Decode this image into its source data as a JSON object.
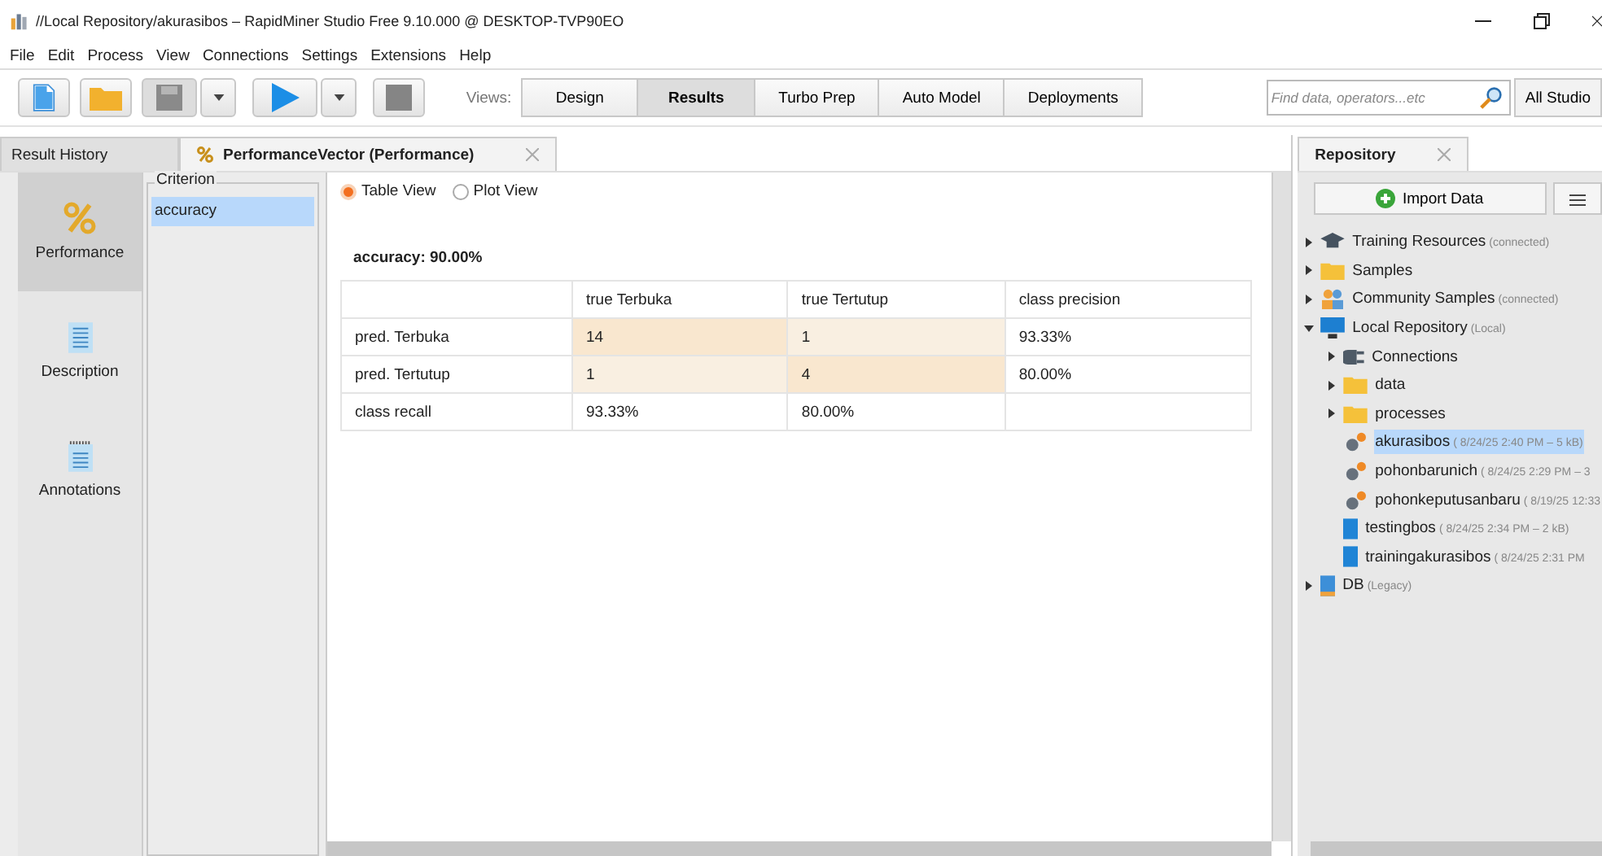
{
  "window": {
    "title": "//Local Repository/akurasibos – RapidMiner Studio Free 9.10.000 @ DESKTOP-TVP90EO"
  },
  "menu": [
    "File",
    "Edit",
    "Process",
    "View",
    "Connections",
    "Settings",
    "Extensions",
    "Help"
  ],
  "toolbar": {
    "views_label": "Views:",
    "views": [
      {
        "label": "Design",
        "selected": false
      },
      {
        "label": "Results",
        "selected": true
      },
      {
        "label": "Turbo Prep",
        "selected": false
      },
      {
        "label": "Auto Model",
        "selected": false
      },
      {
        "label": "Deployments",
        "selected": false
      }
    ],
    "search": {
      "placeholder": "Find data, operators...etc"
    },
    "scope": "All Studio"
  },
  "tabs": [
    {
      "label": "Result History",
      "selected": false,
      "closable": false
    },
    {
      "label": "PerformanceVector (Performance)",
      "selected": true,
      "closable": true
    }
  ],
  "side_nav": [
    {
      "label": "Performance",
      "kind": "percent",
      "selected": true
    },
    {
      "label": "Description",
      "kind": "document",
      "selected": false
    },
    {
      "label": "Annotations",
      "kind": "notepad",
      "selected": false
    }
  ],
  "criterion": {
    "legend": "Criterion",
    "items": [
      {
        "label": "accuracy",
        "selected": true
      }
    ]
  },
  "view_options": [
    {
      "label": "Table View",
      "selected": true
    },
    {
      "label": "Plot View",
      "selected": false
    }
  ],
  "heading": "accuracy: 90.00%",
  "table": {
    "columns": [
      "true Terbuka",
      "true Tertutup",
      "class precision"
    ],
    "rows": [
      {
        "label": "pred. Terbuka",
        "cells": [
          {
            "text": "14",
            "color": "#f9e7cf"
          },
          {
            "text": "1",
            "color": "#f9efe1"
          },
          {
            "text": "93.33%"
          }
        ]
      },
      {
        "label": "pred. Tertutup",
        "cells": [
          {
            "text": "1",
            "color": "#f9efe1"
          },
          {
            "text": "4",
            "color": "#f9e7cf"
          },
          {
            "text": "80.00%"
          }
        ]
      },
      {
        "label": "class recall",
        "cells": [
          {
            "text": "93.33%"
          },
          {
            "text": "80.00%"
          },
          {}
        ]
      }
    ]
  },
  "repository": {
    "title": "Repository",
    "import_button": "Import Data",
    "tree": [
      {
        "label": "Training Resources",
        "note": "(connected)",
        "kind": "training",
        "expanded": false,
        "selected": false
      },
      {
        "label": "Samples",
        "kind": "folder",
        "expanded": false,
        "selected": false
      },
      {
        "label": "Community Samples",
        "note": "(connected)",
        "kind": "community",
        "expanded": false,
        "selected": false
      },
      {
        "label": "Local Repository",
        "note": "(Local)",
        "kind": "computer",
        "expanded": true,
        "selected": false,
        "children": [
          {
            "label": "Connections",
            "kind": "connection",
            "expanded": false,
            "selected": false
          },
          {
            "label": "data",
            "kind": "folder",
            "expanded": false,
            "selected": false
          },
          {
            "label": "processes",
            "kind": "folder",
            "expanded": false,
            "selected": false
          },
          {
            "label": "akurasibos",
            "note": "( 8/24/25 2:40 PM – 5 kB)",
            "kind": "process",
            "selected": true
          },
          {
            "label": "pohonbarunich",
            "note": "( 8/24/25 2:29 PM – 3",
            "kind": "process",
            "selected": false
          },
          {
            "label": "pohonkeputusanbaru",
            "note": "( 8/19/25 12:33",
            "kind": "process",
            "selected": false
          },
          {
            "label": "testingbos",
            "note": "( 8/24/25 2:34 PM – 2 kB)",
            "kind": "data",
            "selected": false
          },
          {
            "label": "trainingakurasibos",
            "note": "( 8/24/25 2:31 PM",
            "kind": "data",
            "selected": false
          }
        ]
      },
      {
        "label": "DB",
        "note": "(Legacy)",
        "kind": "db",
        "expanded": false,
        "selected": false
      }
    ]
  }
}
